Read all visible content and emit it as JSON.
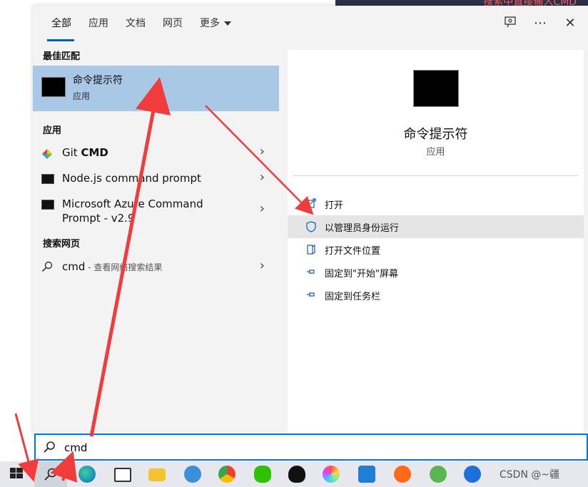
{
  "desktop": {
    "banner_text": "搜索中直接输入CMD"
  },
  "tabs": [
    {
      "label": "全部"
    },
    {
      "label": "应用"
    },
    {
      "label": "文档"
    },
    {
      "label": "网页"
    },
    {
      "label": "更多"
    }
  ],
  "left": {
    "best_match_heading": "最佳匹配",
    "best_match": {
      "title": "命令提示符",
      "subtitle": "应用"
    },
    "apps_heading": "应用",
    "apps": [
      {
        "name_plain": "Git ",
        "name_bold": "CMD"
      },
      {
        "name": "Node.js command prompt"
      },
      {
        "name_line1": "Microsoft Azure Command",
        "name_line2": "Prompt - v2.9"
      }
    ],
    "web_heading": "搜索网页",
    "web_result": {
      "query": "cmd",
      "hint": " - 查看网络搜索结果"
    }
  },
  "detail": {
    "title": "命令提示符",
    "subtitle": "应用",
    "actions": [
      {
        "label": "打开"
      },
      {
        "label": "以管理员身份运行"
      },
      {
        "label": "打开文件位置"
      },
      {
        "label": "固定到\"开始\"屏幕"
      },
      {
        "label": "固定到任务栏"
      }
    ]
  },
  "search": {
    "value": "cmd"
  },
  "taskbar": {
    "watermark": "CSDN @~疆"
  },
  "colors": {
    "accent": "#0078d7",
    "selection": "#a8c8e6",
    "arrow": "#f03c3c"
  }
}
